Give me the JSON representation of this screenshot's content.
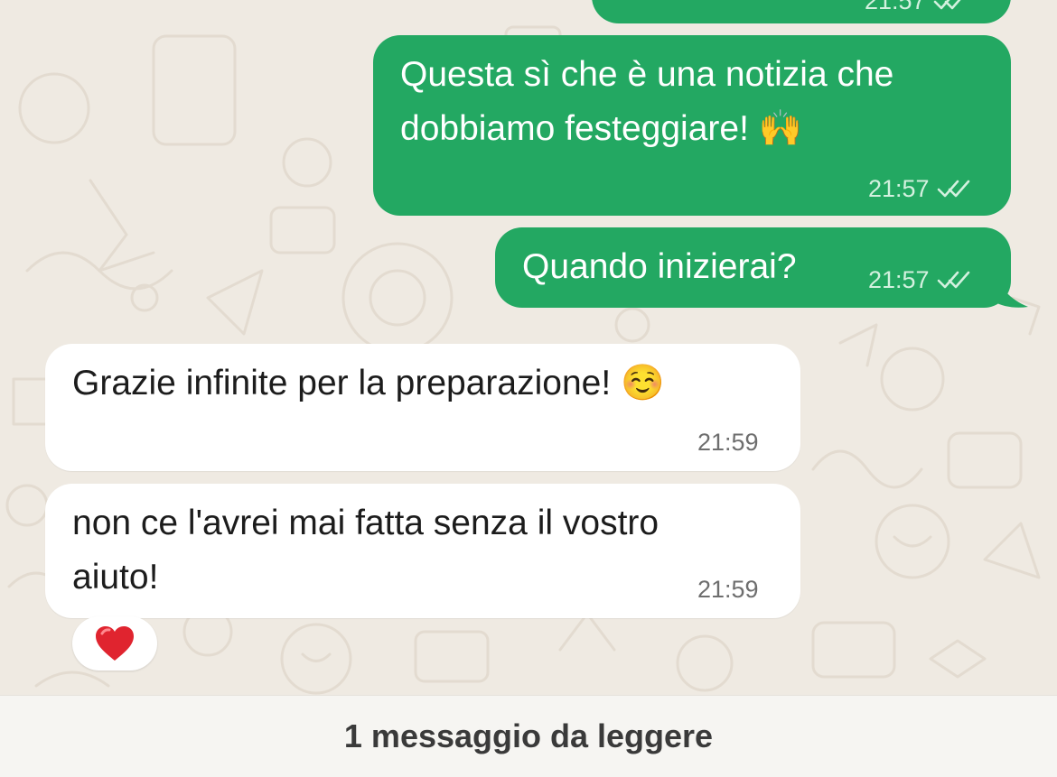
{
  "messages": [
    {
      "direction": "outgoing",
      "text": "",
      "time": "21:57",
      "status": "read"
    },
    {
      "direction": "outgoing",
      "text": "Questa sì che è una notizia che\ndobbiamo festeggiare! 🙌",
      "time": "21:57",
      "status": "read"
    },
    {
      "direction": "outgoing",
      "text": "Quando inizierai?",
      "time": "21:57",
      "status": "read"
    },
    {
      "direction": "incoming",
      "text": "Grazie infinite per la preparazione! ☺️",
      "time": "21:59"
    },
    {
      "direction": "incoming",
      "text": "non ce l'avrei mai fatta senza il vostro\naiuto!",
      "time": "21:59",
      "reaction": "❤️"
    }
  ],
  "unread_banner": "1 messaggio da leggere",
  "colors": {
    "wallpaper": "#efeae2",
    "outgoing_bubble": "#23a862",
    "incoming_bubble": "#ffffff",
    "read_ticks": "#d3f1df",
    "reaction_heart": "#e0242f"
  },
  "icons": {
    "read_status": "double-check-icon",
    "reaction": "heart-icon"
  }
}
